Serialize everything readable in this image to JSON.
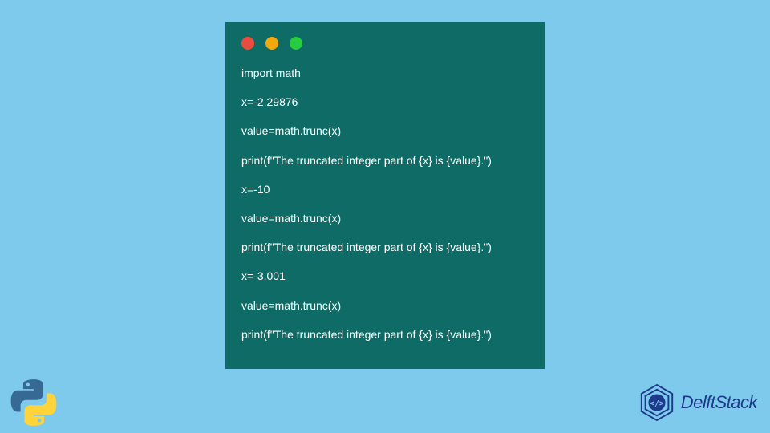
{
  "code": {
    "lines": [
      "import math",
      "x=-2.29876",
      "value=math.trunc(x)",
      "print(f\"The truncated integer part of {x} is {value}.\")",
      "x=-10",
      "value=math.trunc(x)",
      "print(f\"The truncated integer part of {x} is {value}.\")",
      "x=-3.001",
      "value=math.trunc(x)",
      "print(f\"The truncated integer part of {x} is {value}.\")"
    ]
  },
  "brand": {
    "name": "DelftStack"
  },
  "window": {
    "dots": [
      "red",
      "yellow",
      "green"
    ]
  }
}
